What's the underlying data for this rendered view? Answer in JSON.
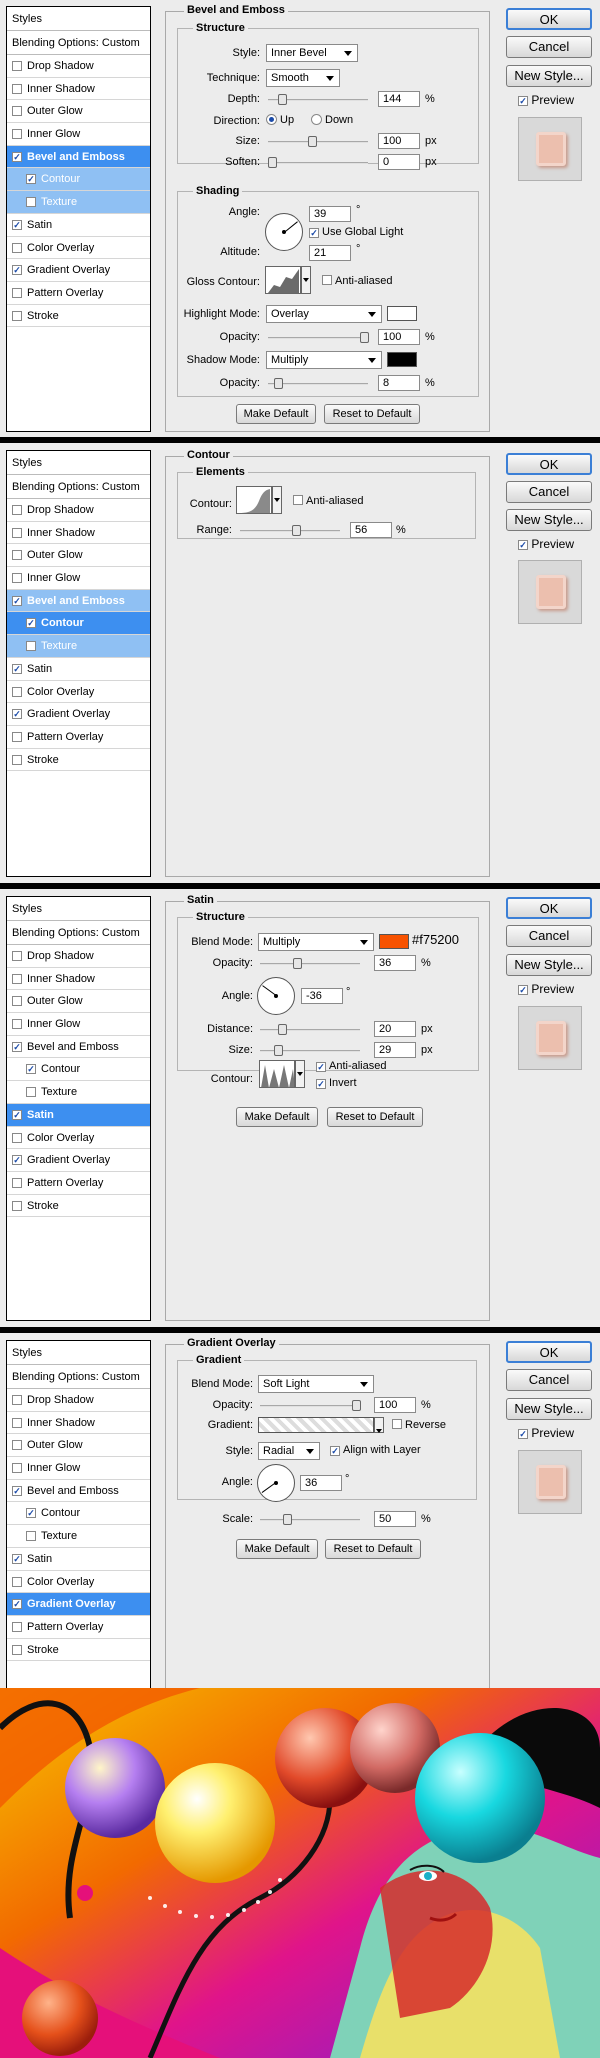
{
  "sidebar": {
    "styles_header": "Styles",
    "blending": "Blending Options: Custom",
    "items": [
      "Drop Shadow",
      "Inner Shadow",
      "Outer Glow",
      "Inner Glow",
      "Bevel and Emboss",
      "Contour",
      "Texture",
      "Satin",
      "Color Overlay",
      "Gradient Overlay",
      "Pattern Overlay",
      "Stroke"
    ]
  },
  "buttons": {
    "ok": "OK",
    "cancel": "Cancel",
    "new_style": "New Style...",
    "preview": "Preview",
    "make_default": "Make Default",
    "reset_default": "Reset to Default"
  },
  "bevel": {
    "title": "Bevel and Emboss",
    "structure": "Structure",
    "shading": "Shading",
    "style_label": "Style:",
    "style_value": "Inner Bevel",
    "technique_label": "Technique:",
    "technique_value": "Smooth",
    "depth_label": "Depth:",
    "depth_value": "144",
    "depth_unit": "%",
    "direction_label": "Direction:",
    "dir_up": "Up",
    "dir_down": "Down",
    "size_label": "Size:",
    "size_value": "100",
    "size_unit": "px",
    "soften_label": "Soften:",
    "soften_value": "0",
    "soften_unit": "px",
    "angle_label": "Angle:",
    "angle_value": "39",
    "deg": "°",
    "global_light": "Use Global Light",
    "altitude_label": "Altitude:",
    "altitude_value": "21",
    "gloss_label": "Gloss Contour:",
    "anti_aliased": "Anti-aliased",
    "highlight_label": "Highlight Mode:",
    "highlight_value": "Overlay",
    "opacity_label": "Opacity:",
    "highlight_opacity": "100",
    "pct": "%",
    "shadow_label": "Shadow Mode:",
    "shadow_value": "Multiply",
    "shadow_opacity": "8"
  },
  "contour": {
    "title": "Contour",
    "elements": "Elements",
    "contour_label": "Contour:",
    "anti_aliased": "Anti-aliased",
    "range_label": "Range:",
    "range_value": "56",
    "pct": "%"
  },
  "satin": {
    "title": "Satin",
    "structure": "Structure",
    "blend_label": "Blend Mode:",
    "blend_value": "Multiply",
    "color_hex": "#f75200",
    "color_label": "#f75200",
    "opacity_label": "Opacity:",
    "opacity_value": "36",
    "pct": "%",
    "angle_label": "Angle:",
    "angle_value": "-36",
    "deg": "°",
    "distance_label": "Distance:",
    "distance_value": "20",
    "px": "px",
    "size_label": "Size:",
    "size_value": "29",
    "contour_label": "Contour:",
    "anti_aliased": "Anti-aliased",
    "invert": "Invert"
  },
  "gradient": {
    "title": "Gradient Overlay",
    "gradient_group": "Gradient",
    "blend_label": "Blend Mode:",
    "blend_value": "Soft Light",
    "opacity_label": "Opacity:",
    "opacity_value": "100",
    "pct": "%",
    "gradient_label": "Gradient:",
    "reverse": "Reverse",
    "style_label": "Style:",
    "style_value": "Radial",
    "align": "Align with Layer",
    "angle_label": "Angle:",
    "angle_value": "36",
    "deg": "°",
    "scale_label": "Scale:",
    "scale_value": "50"
  },
  "colors": {
    "selection": "#3d8ff0",
    "satin": "#f75200"
  }
}
